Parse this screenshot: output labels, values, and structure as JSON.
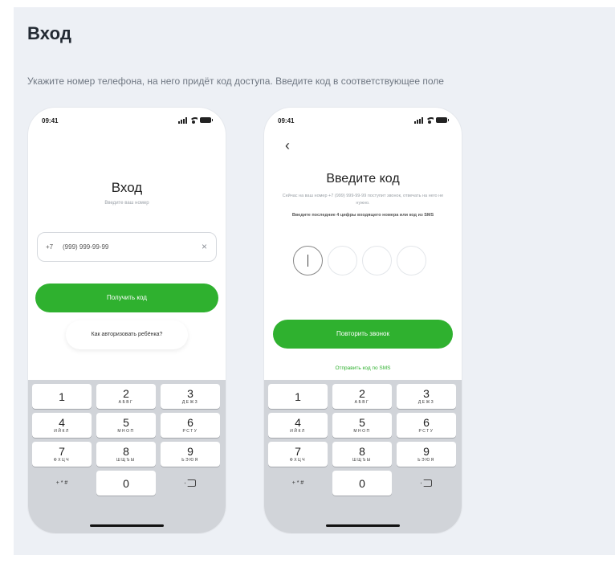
{
  "page": {
    "title": "Вход",
    "subtitle": "Укажите номер телефона, на него придёт код доступа. Введите код в соответствующее поле"
  },
  "status_bar": {
    "time_1": "09:41",
    "time_2": "09:41"
  },
  "screen_login": {
    "heading": "Вход",
    "hint": "Введите ваш номер",
    "phone_prefix": "+7",
    "phone_value": "(999) 999-99-99",
    "clear_icon": "×",
    "get_code_button": "Получить код",
    "child_auth_link": "Как авторизовать ребёнка?"
  },
  "screen_code": {
    "back_icon": "‹",
    "heading": "Введите код",
    "info": "Сейчас на ваш номер +7 (999) 999-99-99 поступит звонок, отвечать на него не нужно.",
    "hint": "Введите последние 4 цифры входящего номера или код из SMS",
    "repeat_call_button": "Повторить звонок",
    "send_sms_link": "Отправить код по SMS"
  },
  "keypad": {
    "keys": [
      {
        "digit": "1",
        "letters": ""
      },
      {
        "digit": "2",
        "letters": "АБВГ"
      },
      {
        "digit": "3",
        "letters": "ДЕЖЗ"
      },
      {
        "digit": "4",
        "letters": "ИЙКЛ"
      },
      {
        "digit": "5",
        "letters": "МНОП"
      },
      {
        "digit": "6",
        "letters": "РСТУ"
      },
      {
        "digit": "7",
        "letters": "ФХЦЧ"
      },
      {
        "digit": "8",
        "letters": "ШЩЪЫ"
      },
      {
        "digit": "9",
        "letters": "ЬЭЮЯ"
      }
    ],
    "symbols": "+ * #",
    "zero": "0"
  },
  "colors": {
    "accent": "#2fb12f",
    "background": "#edf0f5",
    "keypad": "#d1d4d9"
  },
  "icons": [
    "signal-icon",
    "wifi-icon",
    "battery-icon",
    "clear-icon",
    "back-icon",
    "backspace-icon"
  ]
}
